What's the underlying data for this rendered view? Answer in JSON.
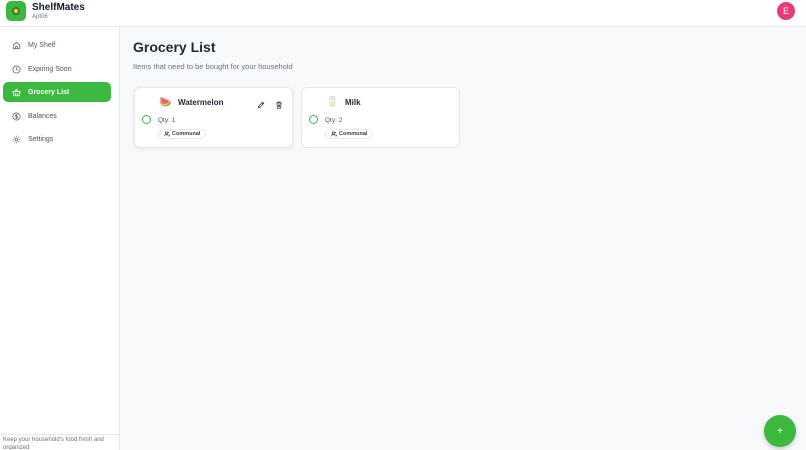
{
  "app": {
    "name": "ShelfMates",
    "household": "Apt06"
  },
  "user": {
    "avatar_initial": "E"
  },
  "sidebar": {
    "items": [
      {
        "label": "My Shelf",
        "icon": "home-icon",
        "active": false
      },
      {
        "label": "Expiring Soon",
        "icon": "clock-icon",
        "active": false
      },
      {
        "label": "Grocery List",
        "icon": "basket-icon",
        "active": true
      },
      {
        "label": "Balances",
        "icon": "dollar-icon",
        "active": false
      },
      {
        "label": "Settings",
        "icon": "gear-icon",
        "active": false
      }
    ],
    "footer": "Keep your household's food fresh and organized"
  },
  "main": {
    "title": "Grocery List",
    "subtitle": "Items that need to be bought for your household",
    "items": [
      {
        "emoji": "🍉",
        "name": "Watermelon",
        "qty": "Qty: 1",
        "tag": "Communal"
      },
      {
        "emoji": "🥛",
        "name": "Milk",
        "qty": "Qty: 2",
        "tag": "Communal"
      }
    ]
  },
  "fab": {
    "label": "+"
  },
  "colors": {
    "accent": "#3db83f",
    "avatar": "#e63b7a"
  }
}
